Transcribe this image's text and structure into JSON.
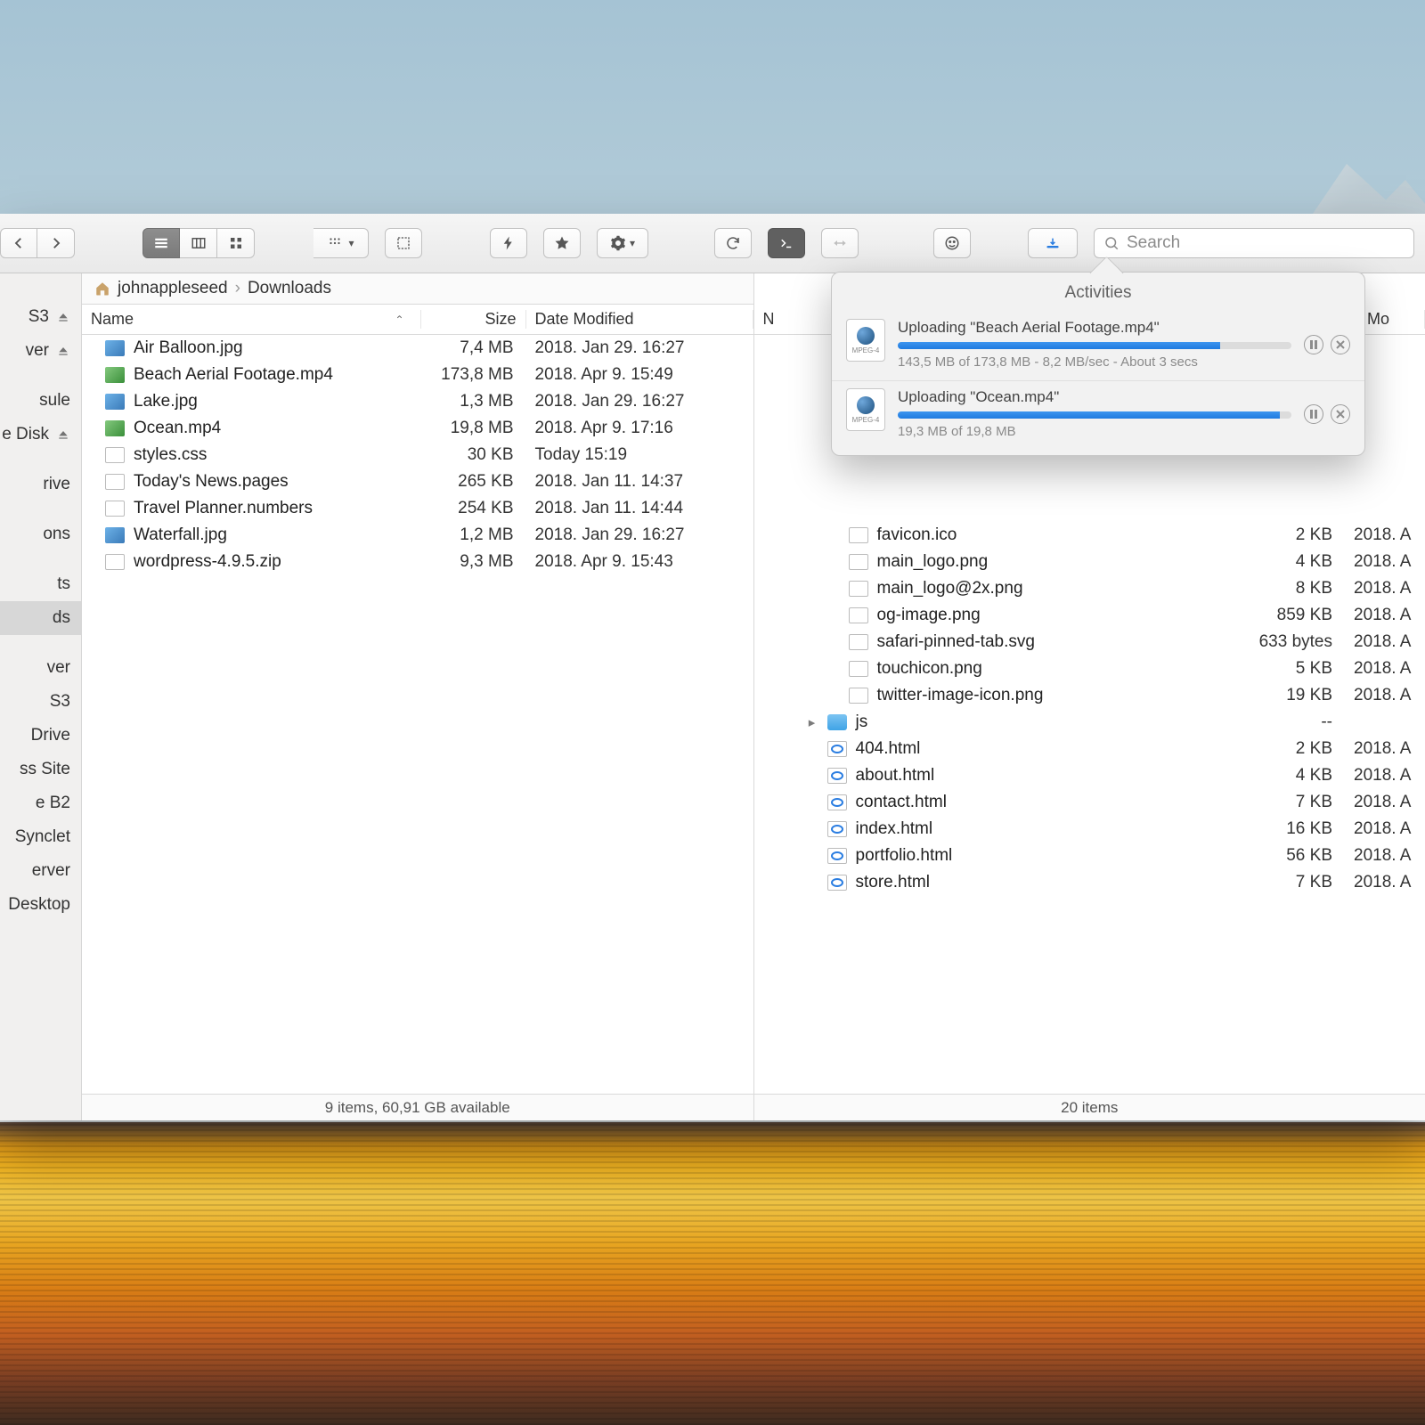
{
  "search": {
    "placeholder": "Search"
  },
  "sidebar": {
    "items": [
      {
        "label": "S3",
        "eject": true
      },
      {
        "label": "ver",
        "eject": true
      },
      {
        "label": "sule",
        "eject": false
      },
      {
        "label": "e Disk",
        "eject": true
      },
      {
        "label": "rive",
        "eject": false
      },
      {
        "label": "ons",
        "eject": false
      },
      {
        "label": "ts",
        "eject": false
      },
      {
        "label": "ds",
        "eject": false,
        "selected": true
      },
      {
        "label": "ver",
        "eject": false
      },
      {
        "label": "S3",
        "eject": false
      },
      {
        "label": "Drive",
        "eject": false
      },
      {
        "label": "ss Site",
        "eject": false
      },
      {
        "label": "e B2",
        "eject": false
      },
      {
        "label": "Synclet",
        "eject": false
      },
      {
        "label": "erver",
        "eject": false
      },
      {
        "label": "Desktop",
        "eject": false
      }
    ]
  },
  "left": {
    "breadcrumb": [
      "johnappleseed",
      "Downloads"
    ],
    "columns": {
      "name": "Name",
      "size": "Size",
      "date": "Date Modified"
    },
    "status": "9 items, 60,91 GB available",
    "rows": [
      {
        "icon": "img",
        "name": "Air Balloon.jpg",
        "size": "7,4 MB",
        "date": "2018. Jan 29. 16:27"
      },
      {
        "icon": "mov",
        "name": "Beach Aerial Footage.mp4",
        "size": "173,8 MB",
        "date": "2018. Apr 9. 15:49"
      },
      {
        "icon": "img",
        "name": "Lake.jpg",
        "size": "1,3 MB",
        "date": "2018. Jan 29. 16:27"
      },
      {
        "icon": "mov",
        "name": "Ocean.mp4",
        "size": "19,8 MB",
        "date": "2018. Apr 9. 17:16"
      },
      {
        "icon": "css",
        "name": "styles.css",
        "size": "30 KB",
        "date": "Today 15:19"
      },
      {
        "icon": "txt",
        "name": "Today's News.pages",
        "size": "265 KB",
        "date": "2018. Jan 11. 14:37"
      },
      {
        "icon": "txt",
        "name": "Travel Planner.numbers",
        "size": "254 KB",
        "date": "2018. Jan 11. 14:44"
      },
      {
        "icon": "img",
        "name": "Waterfall.jpg",
        "size": "1,2 MB",
        "date": "2018. Jan 29. 16:27"
      },
      {
        "icon": "zip",
        "name": "wordpress-4.9.5.zip",
        "size": "9,3 MB",
        "date": "2018. Apr 9. 15:43"
      }
    ]
  },
  "right": {
    "columns": {
      "name": "N",
      "size": "",
      "date": "e Mo"
    },
    "status": "20 items",
    "rows": [
      {
        "icon": "generic",
        "name": "favicon.ico",
        "size": "2 KB",
        "date": "2018. A",
        "indent": 2
      },
      {
        "icon": "generic",
        "name": "main_logo.png",
        "size": "4 KB",
        "date": "2018. A",
        "indent": 2
      },
      {
        "icon": "generic",
        "name": "main_logo@2x.png",
        "size": "8 KB",
        "date": "2018. A",
        "indent": 2
      },
      {
        "icon": "generic",
        "name": "og-image.png",
        "size": "859 KB",
        "date": "2018. A",
        "indent": 2
      },
      {
        "icon": "generic",
        "name": "safari-pinned-tab.svg",
        "size": "633 bytes",
        "date": "2018. A",
        "indent": 2
      },
      {
        "icon": "generic",
        "name": "touchicon.png",
        "size": "5 KB",
        "date": "2018. A",
        "indent": 2
      },
      {
        "icon": "generic",
        "name": "twitter-image-icon.png",
        "size": "19 KB",
        "date": "2018. A",
        "indent": 2
      },
      {
        "icon": "folder",
        "name": "js",
        "size": "--",
        "date": "",
        "indent": 1,
        "disclose": true
      },
      {
        "icon": "html",
        "name": "404.html",
        "size": "2 KB",
        "date": "2018. A",
        "indent": 1
      },
      {
        "icon": "html",
        "name": "about.html",
        "size": "4 KB",
        "date": "2018. A",
        "indent": 1
      },
      {
        "icon": "html",
        "name": "contact.html",
        "size": "7 KB",
        "date": "2018. A",
        "indent": 1
      },
      {
        "icon": "html",
        "name": "index.html",
        "size": "16 KB",
        "date": "2018. A",
        "indent": 1
      },
      {
        "icon": "html",
        "name": "portfolio.html",
        "size": "56 KB",
        "date": "2018. A",
        "indent": 1
      },
      {
        "icon": "html",
        "name": "store.html",
        "size": "7 KB",
        "date": "2018. A",
        "indent": 1
      }
    ]
  },
  "activities": {
    "title": "Activities",
    "icon_label": "MPEG-4",
    "items": [
      {
        "title": "Uploading \"Beach Aerial Footage.mp4\"",
        "detail": "143,5 MB of 173,8 MB - 8,2 MB/sec - About 3 secs",
        "progress": 82
      },
      {
        "title": "Uploading \"Ocean.mp4\"",
        "detail": "19,3 MB of 19,8 MB",
        "progress": 97
      }
    ]
  }
}
